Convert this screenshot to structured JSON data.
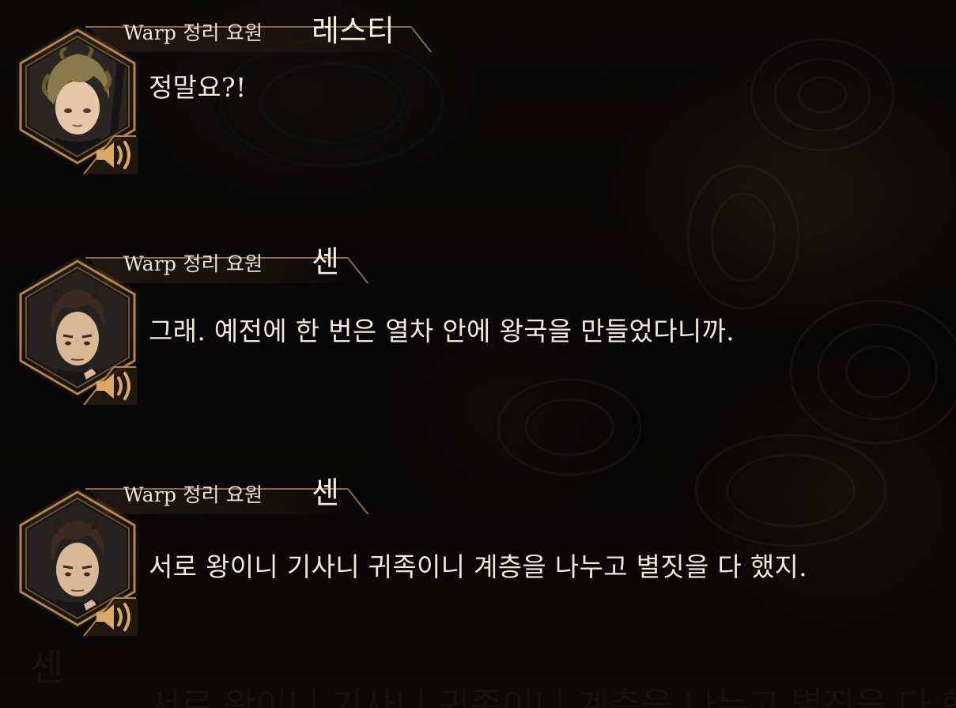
{
  "accent_color": "#b5834a",
  "entries": [
    {
      "role": "Warp 정리 요원",
      "speaker": "레스티",
      "text": "정말요?!",
      "portrait": "portrait-resti",
      "icon": "speaker-icon"
    },
    {
      "role": "Warp 정리 요원",
      "speaker": "센",
      "text": "그래. 예전에 한 번은 열차 안에 왕국을 만들었다니까.",
      "portrait": "portrait-sen",
      "icon": "speaker-icon"
    },
    {
      "role": "Warp 정리 요원",
      "speaker": "센",
      "text": "서로 왕이니 기사니 귀족이니 계층을 나누고 별짓을 다 했지.",
      "portrait": "portrait-sen",
      "icon": "speaker-icon"
    }
  ],
  "ghost": {
    "speaker": "센",
    "text": "서로 왕이니 기사니 귀족이니 계층을 나누고 별짓을 다 했지."
  }
}
